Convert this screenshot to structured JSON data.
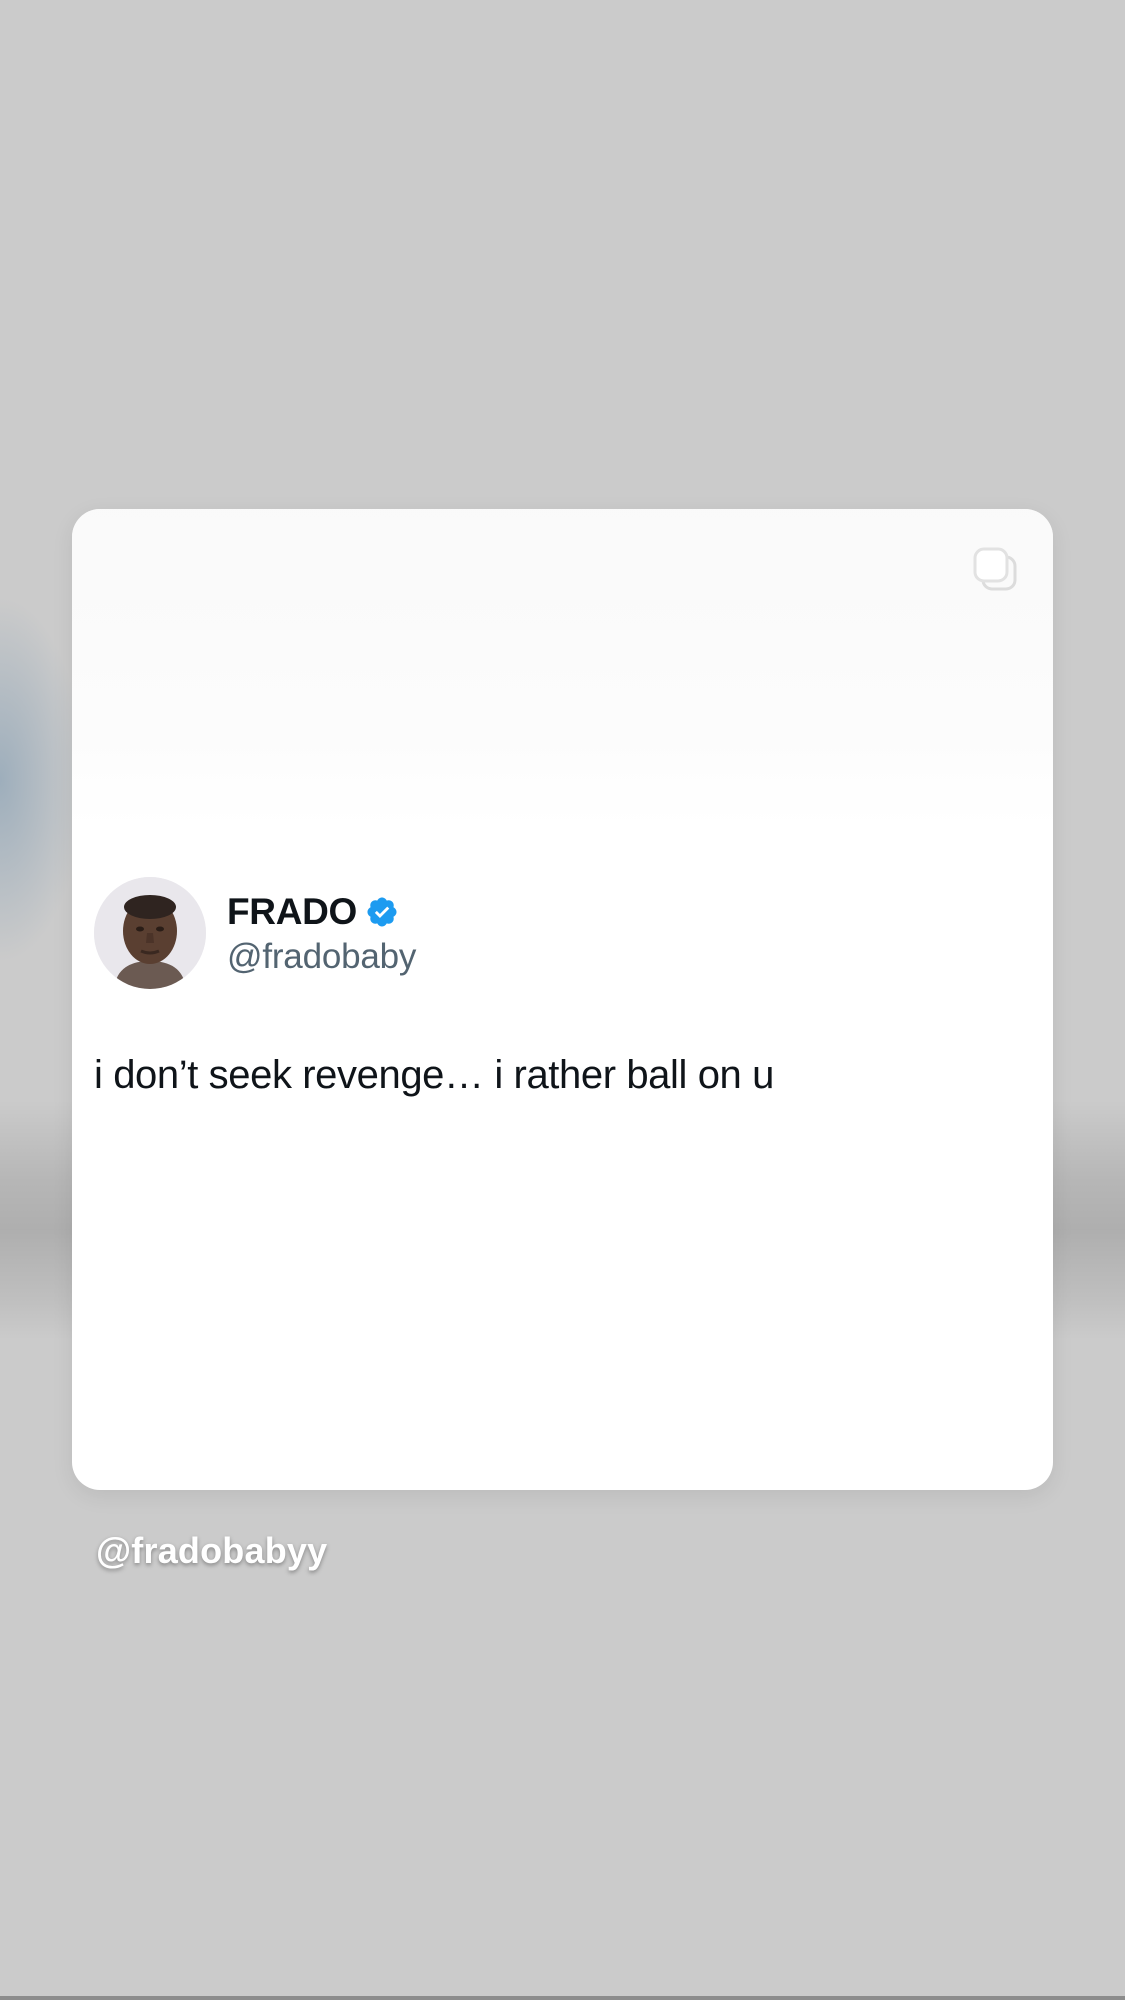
{
  "post": {
    "display_name": "FRADO",
    "handle": "@fradobaby",
    "verified": true,
    "verified_color": "#1d9bf0",
    "text": "i don’t seek revenge… i rather ball on u",
    "icons": {
      "corner": "copy-icon",
      "badge": "verified-icon",
      "avatar": "avatar"
    }
  },
  "story": {
    "mention": "@fradobabyy",
    "background_color": "#cbcbcb"
  }
}
